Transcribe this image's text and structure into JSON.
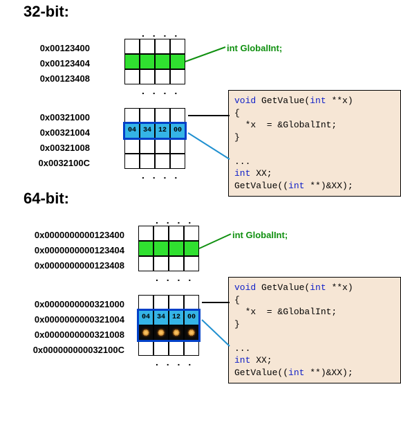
{
  "title32": "32-bit:",
  "title64": "64-bit:",
  "dots": ". . . .",
  "label_globalint": "int GlobalInt;",
  "addr32_top": [
    "0x00123400",
    "0x00123404",
    "0x00123408"
  ],
  "addr32_bot": [
    "0x00321000",
    "0x00321004",
    "0x00321008",
    "0x0032100C"
  ],
  "addr64_top": [
    "0x0000000000123400",
    "0x0000000000123404",
    "0x0000000000123408"
  ],
  "addr64_bot": [
    "0x0000000000321000",
    "0x0000000000321004",
    "0x0000000000321008",
    "0x000000000032100C"
  ],
  "bytes": [
    "04",
    "34",
    "12",
    "00"
  ],
  "code": {
    "kw_void": "void",
    "fn": " GetValue(",
    "kw_int1": "int",
    "sig_rest": " **x)",
    "brace_o": "{",
    "body": "  *x  = &GlobalInt;",
    "brace_c": "}",
    "gap": "...",
    "kw_int2": "int",
    "decl": " XX;",
    "call_a": "GetValue((",
    "kw_int3": "int",
    "call_b": " **)&XX);"
  }
}
